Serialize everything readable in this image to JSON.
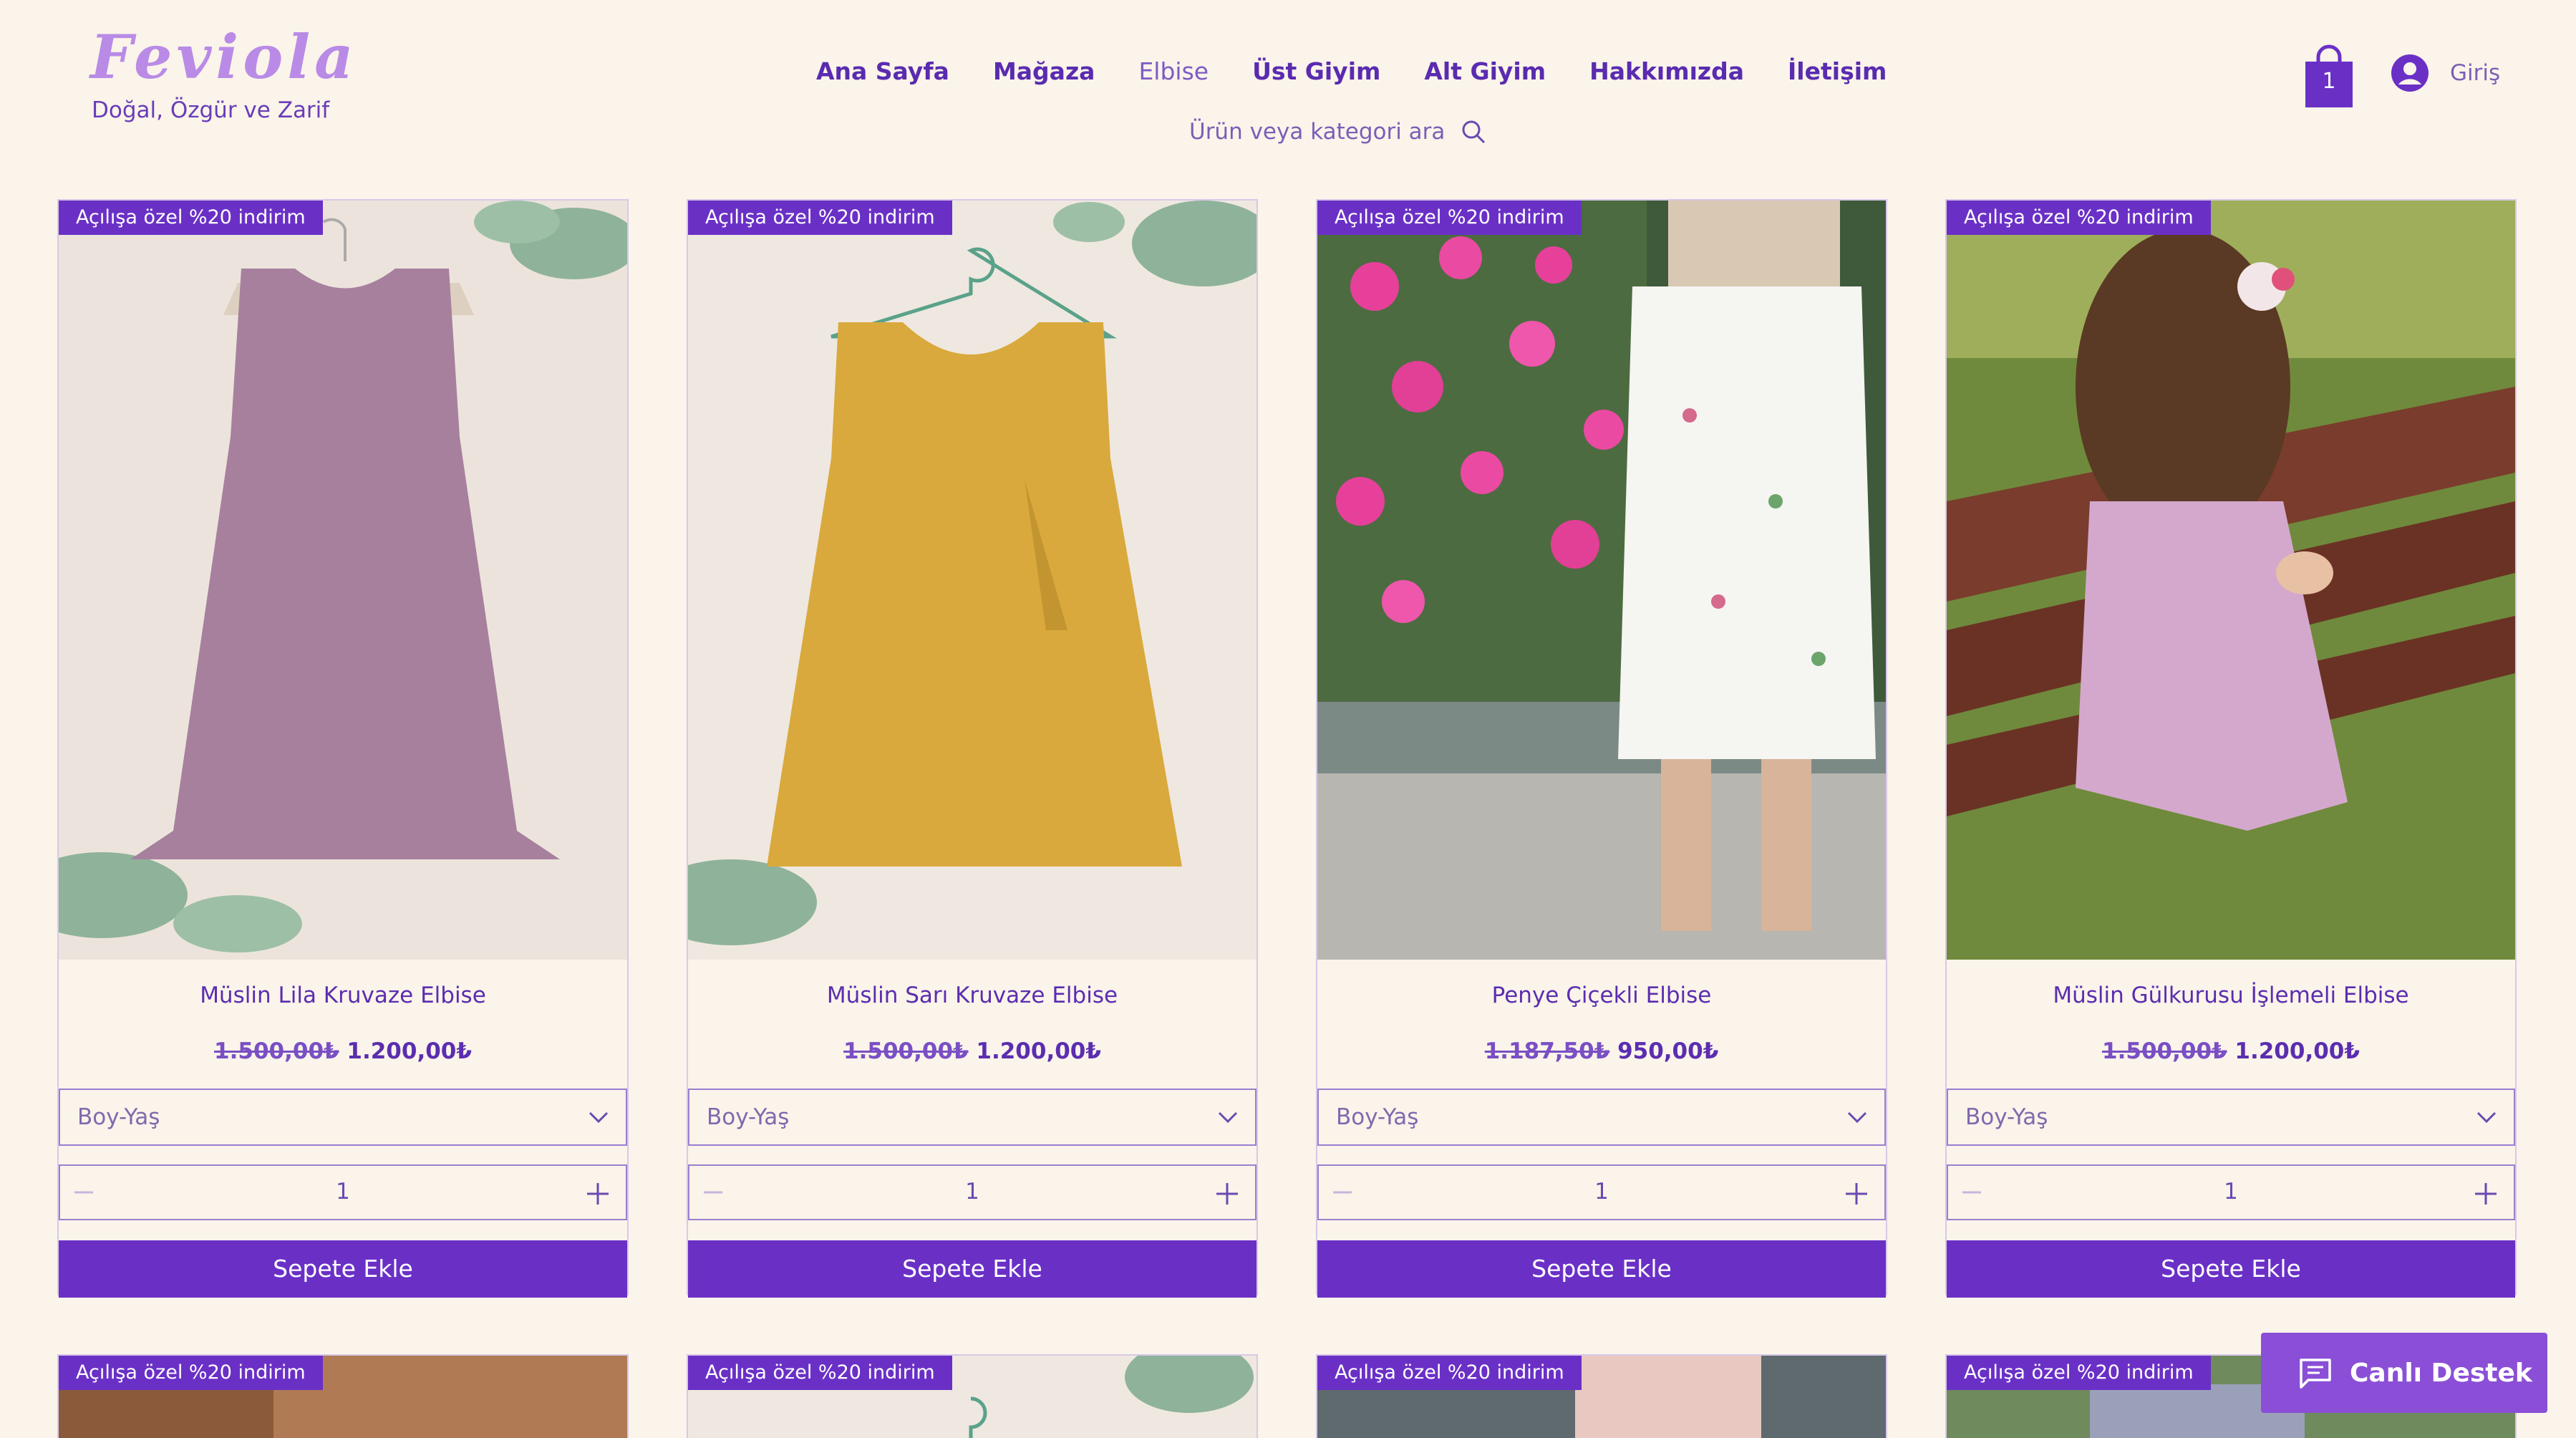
{
  "header": {
    "logo": "Feviola",
    "tagline": "Doğal, Özgür ve Zarif",
    "nav": [
      "Ana Sayfa",
      "Mağaza",
      "Elbise",
      "Üst Giyim",
      "Alt Giyim",
      "Hakkımızda",
      "İletişim"
    ],
    "active_nav": "Elbise",
    "search_text": "Ürün veya kategori ara",
    "cart_count": "1",
    "login": "Giriş"
  },
  "products": [
    {
      "badge": "Açılışa özel %20 indirim",
      "name": "Müslin Lila Kruvaze Elbise",
      "old_price": "1.500,00₺",
      "new_price": "1.200,00₺",
      "select_label": "Boy-Yaş",
      "quantity": "1",
      "button": "Sepete Ekle"
    },
    {
      "badge": "Açılışa özel %20 indirim",
      "name": "Müslin Sarı Kruvaze Elbise",
      "old_price": "1.500,00₺",
      "new_price": "1.200,00₺",
      "select_label": "Boy-Yaş",
      "quantity": "1",
      "button": "Sepete Ekle"
    },
    {
      "badge": "Açılışa özel %20 indirim",
      "name": "Penye Çiçekli Elbise",
      "old_price": "1.187,50₺",
      "new_price": "950,00₺",
      "select_label": "Boy-Yaş",
      "quantity": "1",
      "button": "Sepete Ekle"
    },
    {
      "badge": "Açılışa özel %20 indirim",
      "name": "Müslin Gülkurusu İşlemeli Elbise",
      "old_price": "1.500,00₺",
      "new_price": "1.200,00₺",
      "select_label": "Boy-Yaş",
      "quantity": "1",
      "button": "Sepete Ekle"
    }
  ],
  "second_row_badges": [
    "Açılışa özel %20 indirim",
    "Açılışa özel %20 indirim",
    "Açılışa özel %20 indirim",
    "Açılışa özel %20 indirim"
  ],
  "chat": {
    "label": "Canlı Destek"
  },
  "colors": {
    "accent": "#6a30c6",
    "background": "#faf4ea",
    "logo": "#b98be6",
    "chat": "#8a4fd6"
  }
}
